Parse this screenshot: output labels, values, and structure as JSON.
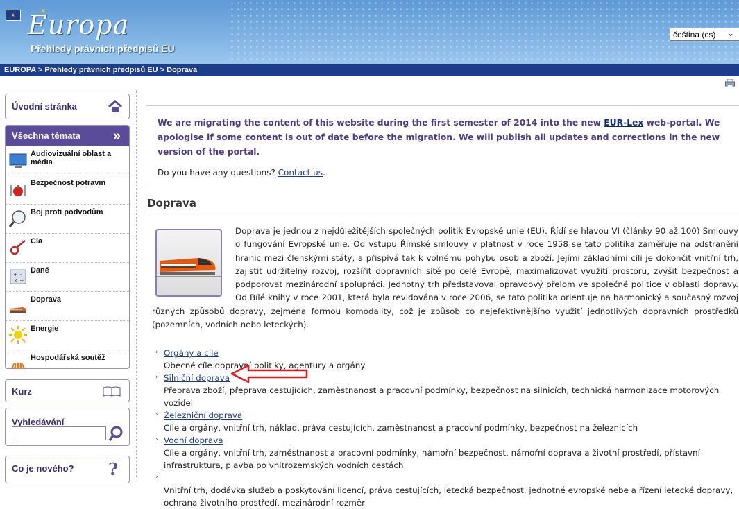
{
  "header": {
    "logo_text": "Europa",
    "site_title": "Přehledy právních předpisů EU",
    "language": "čeština (cs)",
    "breadcrumb": "EUROPA > Přehledy právních předpisů EU > Doprava"
  },
  "sidebar": {
    "home": "Úvodní stránka",
    "all_topics": "Všechna témata",
    "topics": [
      {
        "label": "Audiovizuální oblast a média",
        "icon": "monitor-icon"
      },
      {
        "label": "Bezpečnost potravin",
        "icon": "food-safety-icon"
      },
      {
        "label": "Boj proti podvodům",
        "icon": "magnifier-icon"
      },
      {
        "label": "Cla",
        "icon": "customs-icon"
      },
      {
        "label": "Daně",
        "icon": "calculator-icon"
      },
      {
        "label": "Doprava",
        "icon": "train-icon"
      },
      {
        "label": "Energie",
        "icon": "sun-icon"
      },
      {
        "label": "Hospodářská soutěž",
        "icon": "competition-icon"
      }
    ],
    "kurz": "Kurz",
    "search_label": "Vyhledávání",
    "search_value": "",
    "news": "Co je nového?"
  },
  "notice": {
    "text_before": "We are migrating the content of this website during the first semester of 2014 into the new ",
    "link": "EUR-Lex",
    "text_after": " web-portal. We apologise if some content is out of date before the migration. We will publish all updates and corrections in the new version of the portal.",
    "question": "Do you have any questions? ",
    "contact": "Contact us",
    "question_end": "."
  },
  "main": {
    "title": "Doprava",
    "intro": "Doprava je jednou z nejdůležitějších společných politik Evropské unie (EU). Řídí se hlavou VI (články 90 až 100) Smlouvy o fungování Evropské unie. Od vstupu Římské smlouvy v platnost v roce 1958 se tato politika zaměřuje na odstranění hranic mezi členskými státy, a přispívá tak k volnému pohybu osob a zboží. Jejími základními cíli je dokončit vnitřní trh, zajistit udržitelný rozvoj, rozšířit dopravních sítě po celé Evropě, maximalizovat využití prostoru, zvýšit bezpečnost a podporovat mezinárodní spolupráci. Jednotný trh představoval opravdový přelom ve společné politice v oblasti dopravy. Od Bílé knihy v roce 2001, která byla revidována v roce 2006, se tato politika orientuje na harmonický a současný rozvoj různých způsobů dopravy, zejména formou komodality, což je způsob co nejefektivnějšího využití jednotlivých dopravních prostředků (pozemních, vodních nebo leteckých).",
    "links": [
      {
        "label": "Orgány a cíle",
        "desc": "Obecné cíle dopravní politiky, agentury a orgány"
      },
      {
        "label": "Silniční doprava",
        "desc": "Přeprava zboží, přeprava cestujících, zaměstnanost a pracovní podmínky, bezpečnost na silnicích, technická harmonizace motorových vozidel"
      },
      {
        "label": "Železniční doprava",
        "desc": "Cíle a orgány, vnitřní trh, náklad, práva cestujících, zaměstnanost a pracovní podmínky, bezpečnost na železnicích"
      },
      {
        "label": "Vodní doprava",
        "desc": "Cíle a orgány, vnitřní trh, zaměstnanost a pracovní podmínky, námořní bezpečnost, námořní doprava a životní prostředí, přístavní infrastruktura, plavba po vnitrozemských vodních cestách"
      },
      {
        "label": "",
        "desc": "Vnitřní trh, dodávka služeb a poskytování licencí, práva cestujících, letecká bezpečnost, jednotné evropské nebe a řízení letecké dopravy, ochrana životního prostředí, mezinárodní rozměr"
      }
    ]
  },
  "colors": {
    "nav_dark": "#1c3d8c",
    "sidebar_purple": "#5b4c99",
    "annotation_red": "#e01b1b"
  }
}
